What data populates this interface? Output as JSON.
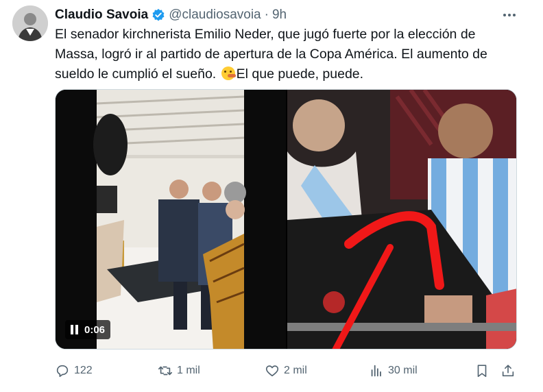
{
  "author": {
    "name": "Claudio Savoia",
    "handle": "@claudiosavoia",
    "separator": "·",
    "time": "9h",
    "verified": true,
    "avatar_icon": "avatar"
  },
  "tweet_text": {
    "line1": "El senador kirchnerista Emilio Neder, que jugó fuerte por la elección de",
    "line2": "Massa, logró ir al partido de apertura de la Copa América. El aumento de",
    "line3a": "sueldo le cumplió el sueño. ",
    "line3b": "El que puede, puede.",
    "emoji_icon": "shushing-face-emoji"
  },
  "media": {
    "video_time": "0:06",
    "video_state_icon": "pause-icon"
  },
  "actions": {
    "replies": "122",
    "retweets": "1 mil",
    "likes": "2 mil",
    "views": "30 mil"
  },
  "colors": {
    "text": "#0f1419",
    "secondary": "#536471",
    "verified": "#1d9bf0",
    "border": "#cfd9de"
  }
}
